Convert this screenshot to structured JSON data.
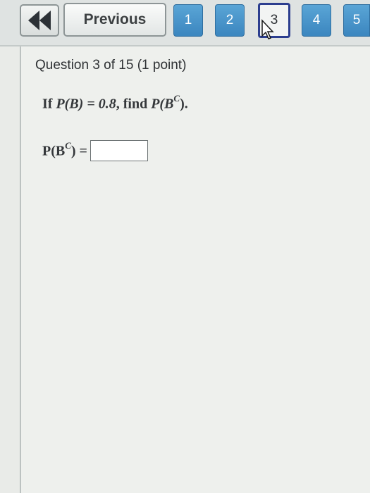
{
  "nav": {
    "back_icon": "double-left-arrow-icon",
    "previous_label": "Previous",
    "pages": [
      "1",
      "2",
      "3",
      "4",
      "5"
    ],
    "current_page": "3",
    "accent_color": "#4a96cd",
    "current_border_color": "#2c3e8f"
  },
  "question": {
    "header": "Question 3 of 15 (1 point)",
    "prompt_prefix": "If ",
    "prompt_given": "P(B) = 0.8",
    "prompt_mid": ", find ",
    "prompt_target_base": "P(B",
    "prompt_target_sup": "C",
    "prompt_end": ").",
    "answer_label_base": "P(B",
    "answer_label_sup": "C",
    "answer_label_end": ") =",
    "answer_value": ""
  }
}
